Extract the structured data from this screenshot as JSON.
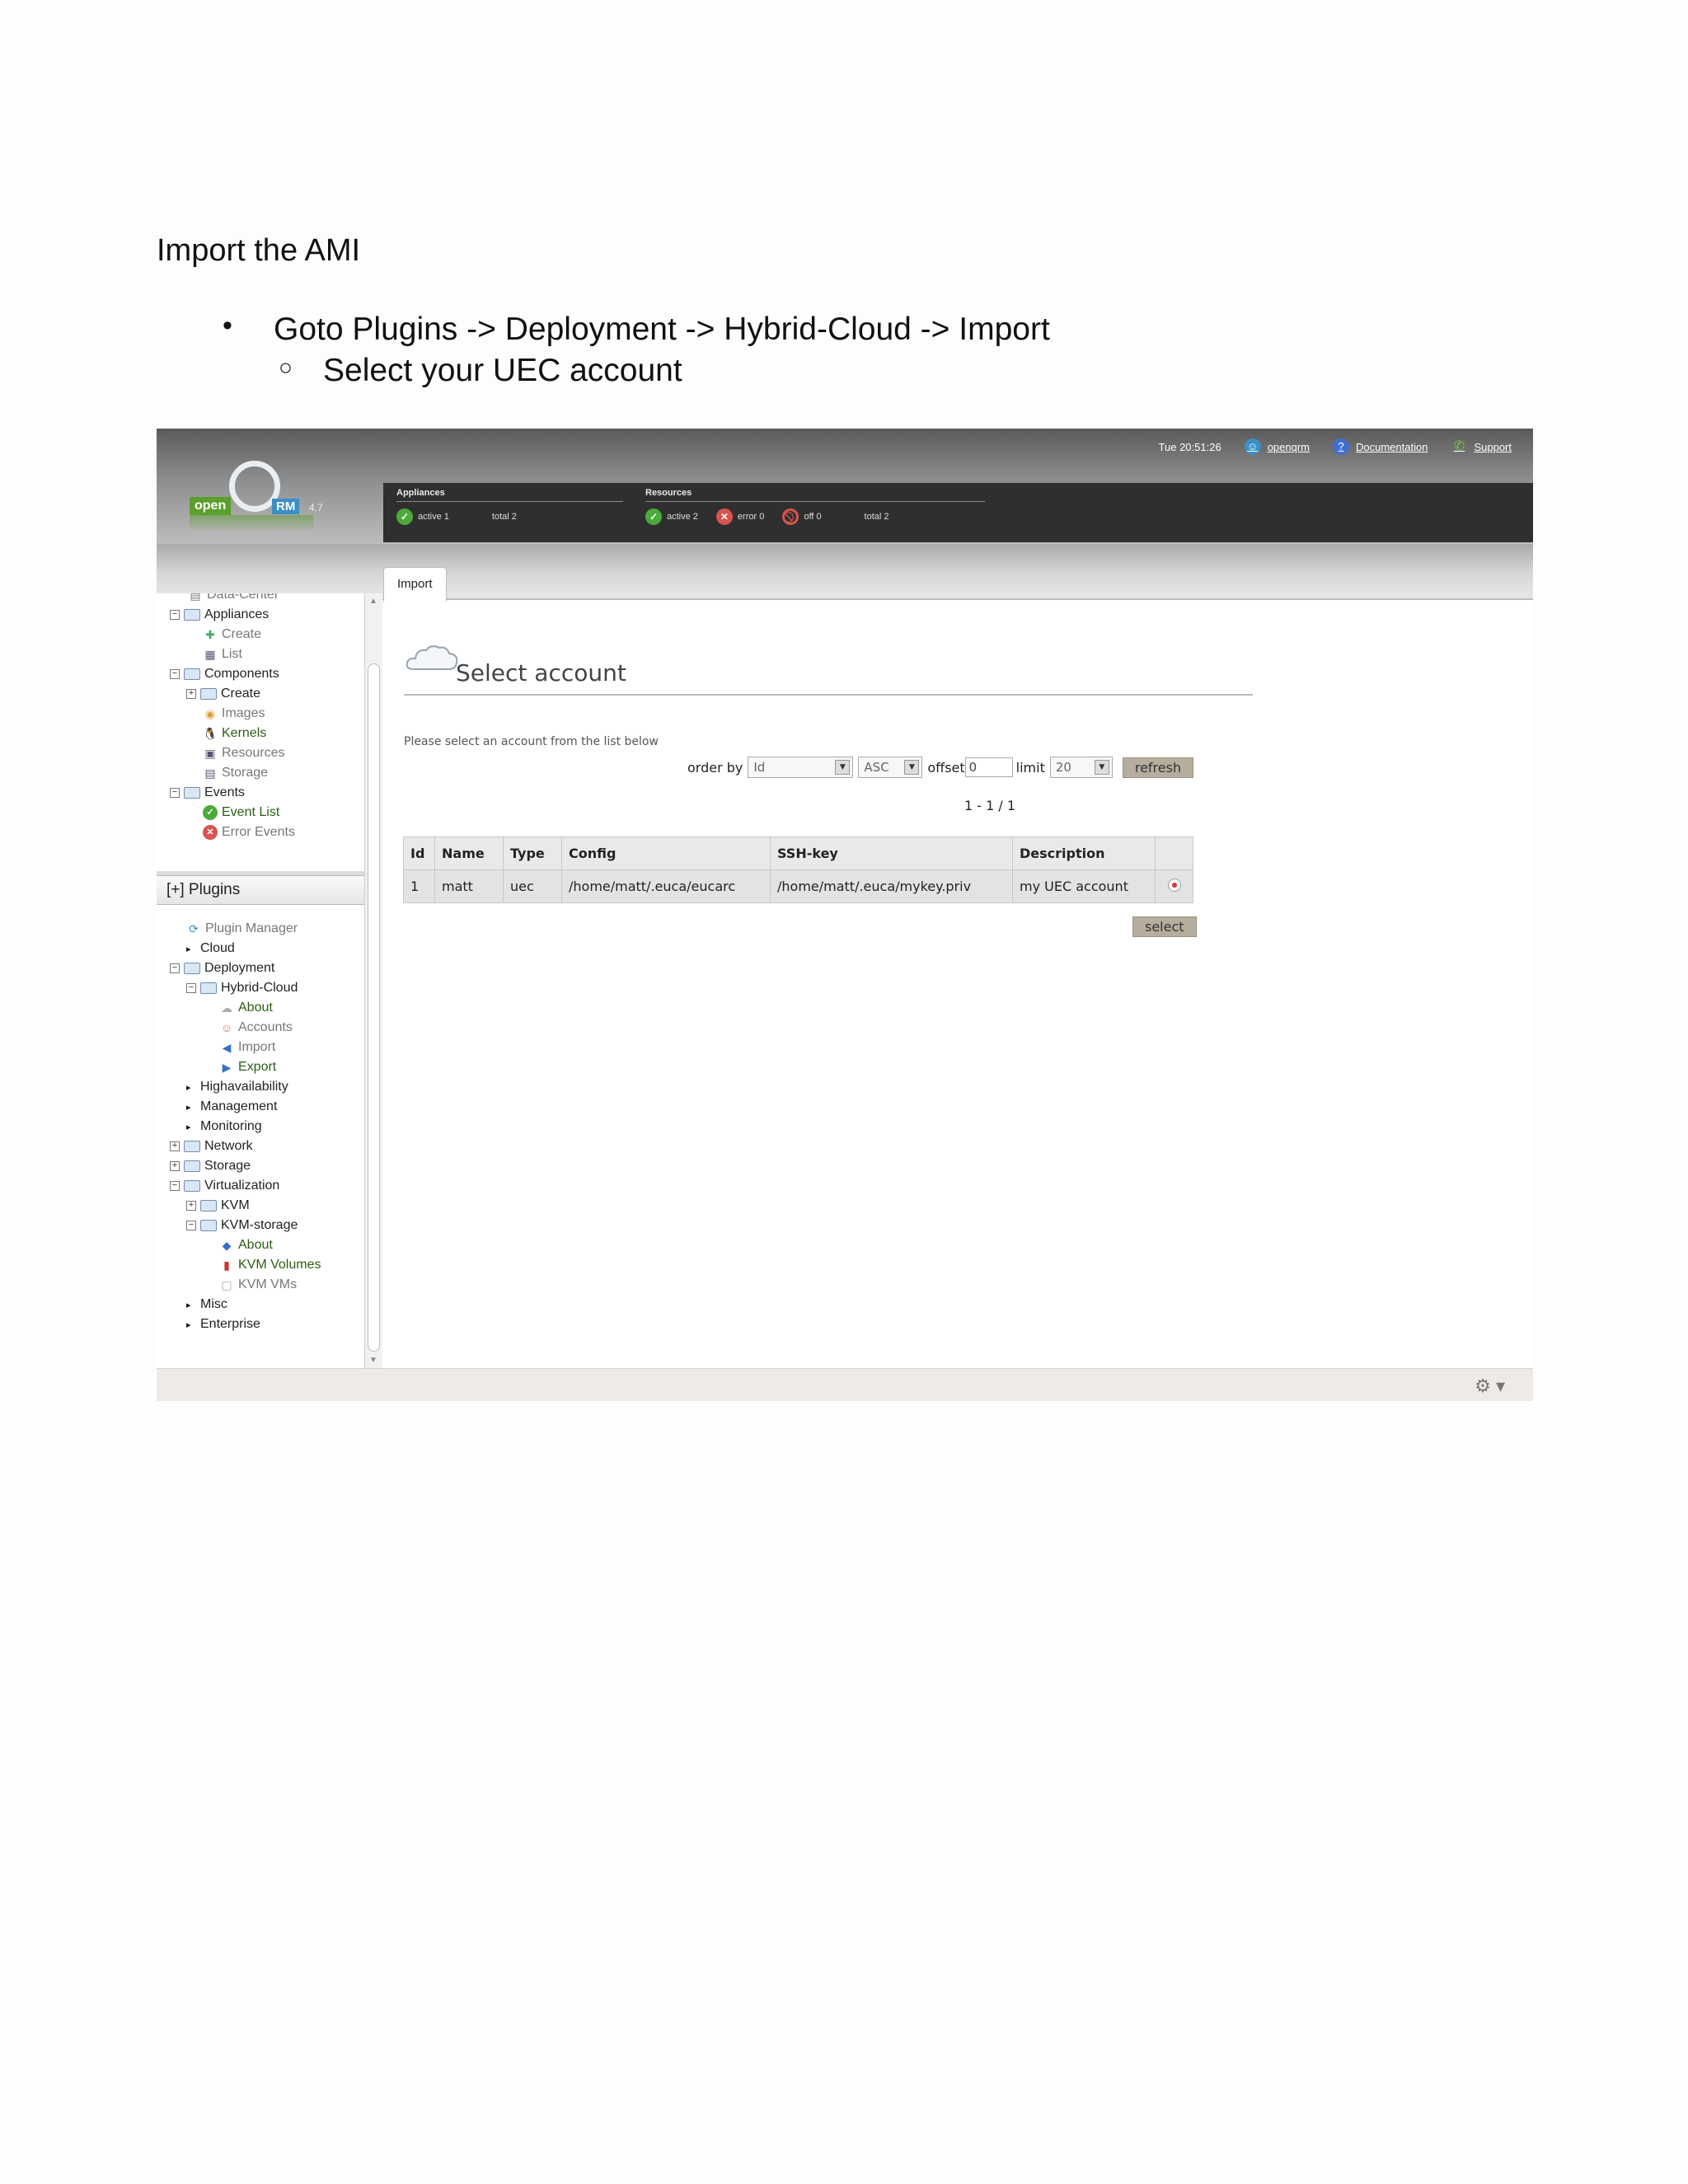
{
  "doc": {
    "heading": "Import the AMI",
    "bullet1": "Goto Plugins -> Deployment -> Hybrid-Cloud -> Import",
    "bullet2": "Select your UEC account",
    "bullet1_marker": "•",
    "bullet2_marker": "○"
  },
  "topbar": {
    "time": "Tue 20:51:26",
    "user_link": "openqrm",
    "documentation_link": "Documentation",
    "support_link": "Support"
  },
  "logo": {
    "open": "open",
    "rm": "RM",
    "version": "4.7"
  },
  "status": {
    "appliances": {
      "title": "Appliances",
      "active": "active 1",
      "total": "total 2"
    },
    "resources": {
      "title": "Resources",
      "active": "active 2",
      "error": "error 0",
      "off": "off 0",
      "total": "total 2"
    }
  },
  "tab": {
    "label": "Import"
  },
  "sidebar": {
    "items": [
      {
        "label": "Data-Center",
        "style": "muted"
      },
      {
        "label": "Appliances",
        "style": "normal"
      },
      {
        "label": "Create",
        "style": "muted"
      },
      {
        "label": "List",
        "style": "muted"
      },
      {
        "label": "Components",
        "style": "normal"
      },
      {
        "label": "Create",
        "style": "normal"
      },
      {
        "label": "Images",
        "style": "muted"
      },
      {
        "label": "Kernels",
        "style": "green"
      },
      {
        "label": "Resources",
        "style": "muted"
      },
      {
        "label": "Storage",
        "style": "muted"
      },
      {
        "label": "Events",
        "style": "normal"
      },
      {
        "label": "Event List",
        "style": "green"
      },
      {
        "label": "Error Events",
        "style": "muted"
      }
    ],
    "plugins_header": "[+] Plugins",
    "plugins": [
      {
        "label": "Plugin Manager",
        "style": "muted"
      },
      {
        "label": "Cloud",
        "style": "normal"
      },
      {
        "label": "Deployment",
        "style": "normal"
      },
      {
        "label": "Hybrid-Cloud",
        "style": "normal"
      },
      {
        "label": "About",
        "style": "green"
      },
      {
        "label": "Accounts",
        "style": "muted"
      },
      {
        "label": "Import",
        "style": "muted"
      },
      {
        "label": "Export",
        "style": "green"
      },
      {
        "label": "Highavailability",
        "style": "normal"
      },
      {
        "label": "Management",
        "style": "normal"
      },
      {
        "label": "Monitoring",
        "style": "normal"
      },
      {
        "label": "Network",
        "style": "normal"
      },
      {
        "label": "Storage",
        "style": "normal"
      },
      {
        "label": "Virtualization",
        "style": "normal"
      },
      {
        "label": "KVM",
        "style": "normal"
      },
      {
        "label": "KVM-storage",
        "style": "normal"
      },
      {
        "label": "About",
        "style": "green"
      },
      {
        "label": "KVM Volumes",
        "style": "green"
      },
      {
        "label": "KVM VMs",
        "style": "muted"
      },
      {
        "label": "Misc",
        "style": "normal"
      },
      {
        "label": "Enterprise",
        "style": "normal"
      }
    ]
  },
  "content": {
    "title": "Select account",
    "instruction": "Please select an account from the list below",
    "order_by_label": "order by",
    "order_by_value": "Id",
    "sort_value": "ASC",
    "offset_label": "offset",
    "offset_value": "0",
    "limit_label": "limit",
    "limit_value": "20",
    "refresh_label": "refresh",
    "pager": "1 - 1 / 1",
    "select_label": "select",
    "table": {
      "headers": [
        "Id",
        "Name",
        "Type",
        "Config",
        "SSH-key",
        "Description",
        ""
      ],
      "rows": [
        [
          "1",
          "matt",
          "uec",
          "/home/matt/.euca/eucarc",
          "/home/matt/.euca/mykey.priv",
          "my UEC account"
        ]
      ]
    }
  },
  "colors": {
    "ok": "#4caa39",
    "error": "#d9534f",
    "button": "#b7ad9e"
  }
}
